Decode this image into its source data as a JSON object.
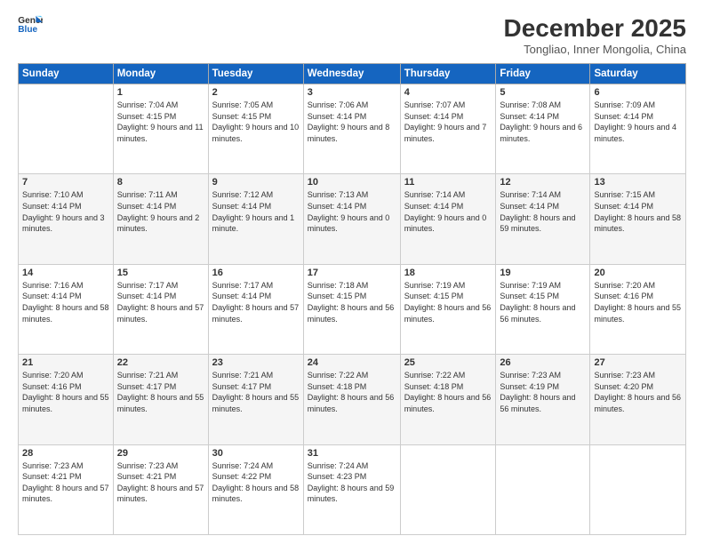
{
  "header": {
    "logo_general": "General",
    "logo_blue": "Blue",
    "month_title": "December 2025",
    "location": "Tongliao, Inner Mongolia, China"
  },
  "weekdays": [
    "Sunday",
    "Monday",
    "Tuesday",
    "Wednesday",
    "Thursday",
    "Friday",
    "Saturday"
  ],
  "weeks": [
    [
      {
        "day": "",
        "sunrise": "",
        "sunset": "",
        "daylight": ""
      },
      {
        "day": "1",
        "sunrise": "Sunrise: 7:04 AM",
        "sunset": "Sunset: 4:15 PM",
        "daylight": "Daylight: 9 hours and 11 minutes."
      },
      {
        "day": "2",
        "sunrise": "Sunrise: 7:05 AM",
        "sunset": "Sunset: 4:15 PM",
        "daylight": "Daylight: 9 hours and 10 minutes."
      },
      {
        "day": "3",
        "sunrise": "Sunrise: 7:06 AM",
        "sunset": "Sunset: 4:14 PM",
        "daylight": "Daylight: 9 hours and 8 minutes."
      },
      {
        "day": "4",
        "sunrise": "Sunrise: 7:07 AM",
        "sunset": "Sunset: 4:14 PM",
        "daylight": "Daylight: 9 hours and 7 minutes."
      },
      {
        "day": "5",
        "sunrise": "Sunrise: 7:08 AM",
        "sunset": "Sunset: 4:14 PM",
        "daylight": "Daylight: 9 hours and 6 minutes."
      },
      {
        "day": "6",
        "sunrise": "Sunrise: 7:09 AM",
        "sunset": "Sunset: 4:14 PM",
        "daylight": "Daylight: 9 hours and 4 minutes."
      }
    ],
    [
      {
        "day": "7",
        "sunrise": "Sunrise: 7:10 AM",
        "sunset": "Sunset: 4:14 PM",
        "daylight": "Daylight: 9 hours and 3 minutes."
      },
      {
        "day": "8",
        "sunrise": "Sunrise: 7:11 AM",
        "sunset": "Sunset: 4:14 PM",
        "daylight": "Daylight: 9 hours and 2 minutes."
      },
      {
        "day": "9",
        "sunrise": "Sunrise: 7:12 AM",
        "sunset": "Sunset: 4:14 PM",
        "daylight": "Daylight: 9 hours and 1 minute."
      },
      {
        "day": "10",
        "sunrise": "Sunrise: 7:13 AM",
        "sunset": "Sunset: 4:14 PM",
        "daylight": "Daylight: 9 hours and 0 minutes."
      },
      {
        "day": "11",
        "sunrise": "Sunrise: 7:14 AM",
        "sunset": "Sunset: 4:14 PM",
        "daylight": "Daylight: 9 hours and 0 minutes."
      },
      {
        "day": "12",
        "sunrise": "Sunrise: 7:14 AM",
        "sunset": "Sunset: 4:14 PM",
        "daylight": "Daylight: 8 hours and 59 minutes."
      },
      {
        "day": "13",
        "sunrise": "Sunrise: 7:15 AM",
        "sunset": "Sunset: 4:14 PM",
        "daylight": "Daylight: 8 hours and 58 minutes."
      }
    ],
    [
      {
        "day": "14",
        "sunrise": "Sunrise: 7:16 AM",
        "sunset": "Sunset: 4:14 PM",
        "daylight": "Daylight: 8 hours and 58 minutes."
      },
      {
        "day": "15",
        "sunrise": "Sunrise: 7:17 AM",
        "sunset": "Sunset: 4:14 PM",
        "daylight": "Daylight: 8 hours and 57 minutes."
      },
      {
        "day": "16",
        "sunrise": "Sunrise: 7:17 AM",
        "sunset": "Sunset: 4:14 PM",
        "daylight": "Daylight: 8 hours and 57 minutes."
      },
      {
        "day": "17",
        "sunrise": "Sunrise: 7:18 AM",
        "sunset": "Sunset: 4:15 PM",
        "daylight": "Daylight: 8 hours and 56 minutes."
      },
      {
        "day": "18",
        "sunrise": "Sunrise: 7:19 AM",
        "sunset": "Sunset: 4:15 PM",
        "daylight": "Daylight: 8 hours and 56 minutes."
      },
      {
        "day": "19",
        "sunrise": "Sunrise: 7:19 AM",
        "sunset": "Sunset: 4:15 PM",
        "daylight": "Daylight: 8 hours and 56 minutes."
      },
      {
        "day": "20",
        "sunrise": "Sunrise: 7:20 AM",
        "sunset": "Sunset: 4:16 PM",
        "daylight": "Daylight: 8 hours and 55 minutes."
      }
    ],
    [
      {
        "day": "21",
        "sunrise": "Sunrise: 7:20 AM",
        "sunset": "Sunset: 4:16 PM",
        "daylight": "Daylight: 8 hours and 55 minutes."
      },
      {
        "day": "22",
        "sunrise": "Sunrise: 7:21 AM",
        "sunset": "Sunset: 4:17 PM",
        "daylight": "Daylight: 8 hours and 55 minutes."
      },
      {
        "day": "23",
        "sunrise": "Sunrise: 7:21 AM",
        "sunset": "Sunset: 4:17 PM",
        "daylight": "Daylight: 8 hours and 55 minutes."
      },
      {
        "day": "24",
        "sunrise": "Sunrise: 7:22 AM",
        "sunset": "Sunset: 4:18 PM",
        "daylight": "Daylight: 8 hours and 56 minutes."
      },
      {
        "day": "25",
        "sunrise": "Sunrise: 7:22 AM",
        "sunset": "Sunset: 4:18 PM",
        "daylight": "Daylight: 8 hours and 56 minutes."
      },
      {
        "day": "26",
        "sunrise": "Sunrise: 7:23 AM",
        "sunset": "Sunset: 4:19 PM",
        "daylight": "Daylight: 8 hours and 56 minutes."
      },
      {
        "day": "27",
        "sunrise": "Sunrise: 7:23 AM",
        "sunset": "Sunset: 4:20 PM",
        "daylight": "Daylight: 8 hours and 56 minutes."
      }
    ],
    [
      {
        "day": "28",
        "sunrise": "Sunrise: 7:23 AM",
        "sunset": "Sunset: 4:21 PM",
        "daylight": "Daylight: 8 hours and 57 minutes."
      },
      {
        "day": "29",
        "sunrise": "Sunrise: 7:23 AM",
        "sunset": "Sunset: 4:21 PM",
        "daylight": "Daylight: 8 hours and 57 minutes."
      },
      {
        "day": "30",
        "sunrise": "Sunrise: 7:24 AM",
        "sunset": "Sunset: 4:22 PM",
        "daylight": "Daylight: 8 hours and 58 minutes."
      },
      {
        "day": "31",
        "sunrise": "Sunrise: 7:24 AM",
        "sunset": "Sunset: 4:23 PM",
        "daylight": "Daylight: 8 hours and 59 minutes."
      },
      {
        "day": "",
        "sunrise": "",
        "sunset": "",
        "daylight": ""
      },
      {
        "day": "",
        "sunrise": "",
        "sunset": "",
        "daylight": ""
      },
      {
        "day": "",
        "sunrise": "",
        "sunset": "",
        "daylight": ""
      }
    ]
  ]
}
